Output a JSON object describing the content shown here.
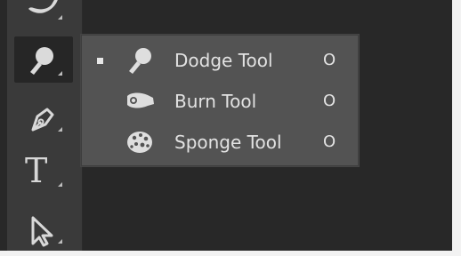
{
  "toolbar": {
    "tools": [
      {
        "icon": "hand-icon-partial"
      },
      {
        "icon": "dodge-icon"
      },
      {
        "icon": "pen-icon"
      },
      {
        "label": "T",
        "icon": "type-icon"
      },
      {
        "icon": "path-selection-icon"
      }
    ]
  },
  "flyout": {
    "items": [
      {
        "label": "Dodge Tool",
        "shortcut": "O",
        "icon": "dodge-icon",
        "selected": true
      },
      {
        "label": "Burn Tool",
        "shortcut": "O",
        "icon": "burn-icon",
        "selected": false
      },
      {
        "label": "Sponge Tool",
        "shortcut": "O",
        "icon": "sponge-icon",
        "selected": false
      }
    ]
  },
  "colors": {
    "canvas": "#282828",
    "panel": "#3a3a3a",
    "flyout": "#535353",
    "text": "#e2e2e2"
  }
}
